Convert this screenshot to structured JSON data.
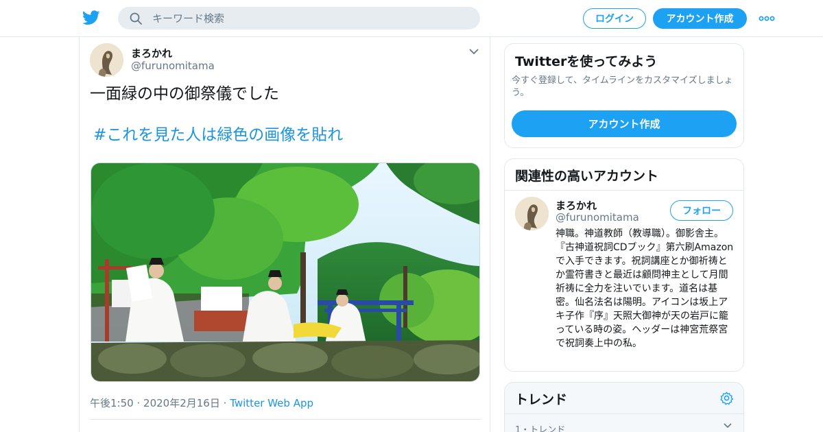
{
  "header": {
    "search_placeholder": "キーワード検索",
    "login_label": "ログイン",
    "signup_label": "アカウント作成"
  },
  "tweet": {
    "user_name": "まろかれ",
    "user_handle": "@furunomitama",
    "text": "一面緑の中の御祭儀でした",
    "hashtag": "#これを見た人は緑色の画像を貼れ",
    "time": "午後1:50",
    "date": "2020年2月16日",
    "separator": "·",
    "source": "Twitter Web App"
  },
  "sidebar": {
    "try": {
      "title": "Twitterを使ってみよう",
      "text": "今すぐ登録して、タイムラインをカスタマイズしましょう。",
      "button_label": "アカウント作成"
    },
    "related": {
      "title": "関連性の高いアカウント",
      "user_name": "まろかれ",
      "user_handle": "@furunomitama",
      "follow_label": "フォロー",
      "bio": "神職。神道教師（教導職）。御影舎主。『古神道祝詞CDブック』第六刷Amazonで入手できます。祝詞講座とか御祈祷とか霊符書きと最近は顧問神主として月間祈祷に全力を注いでいます。道名は基密。仙名法名は陽明。アイコンは坂上アキ子作『序』天照大御神が天の岩戸に籠っている時の姿。ヘッダーは神宮荒祭宮で祝詞奏上中の私。"
    },
    "trends": {
      "title": "トレンド",
      "first_trend_meta": "1・トレンド"
    }
  },
  "colors": {
    "accent": "#1da1f2",
    "link": "#1b95e0",
    "secondary_text": "#657786",
    "border": "#e1e8ed"
  },
  "icons": {
    "logo": "twitter-bird-icon",
    "search": "search-icon",
    "more": "more-dots-icon",
    "caret": "chevron-down-icon",
    "trends_settings": "gear-icon"
  }
}
